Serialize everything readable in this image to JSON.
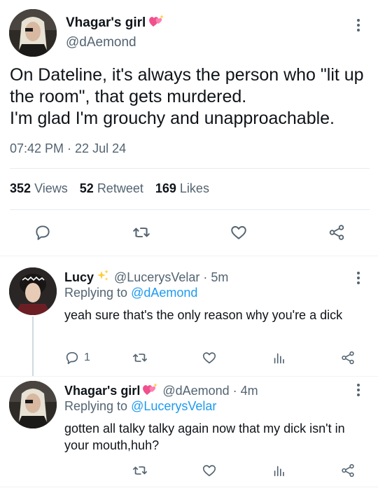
{
  "main_tweet": {
    "display_name": "Vhagar's girl",
    "handle": "@dAemond",
    "text": "On Dateline, it's always the person who \"lit up the room\", that gets murdered.\nI'm glad I'm grouchy and unapproachable.",
    "timestamp": "07:42 PM · 22 Jul 24",
    "stats": {
      "views_count": "352",
      "views_label": "Views",
      "retweets_count": "52",
      "retweets_label": "Retweet",
      "likes_count": "169",
      "likes_label": "Likes"
    }
  },
  "replies": [
    {
      "display_name": "Lucy",
      "handle_time": "@LucerysVelar · 5m",
      "replying_prefix": "Replying to",
      "replying_to": "@dAemond",
      "text": "yeah sure that's the only reason why you're a dick",
      "reply_count": "1"
    },
    {
      "display_name": "Vhagar's girl",
      "handle_time": "@dAemond · 4m",
      "replying_prefix": "Replying to",
      "replying_to": "@LucerysVelar",
      "text": "gotten all talky talky again now that my dick isn't in your mouth,huh?",
      "reply_count": ""
    }
  ],
  "icons": {
    "reply": "comment-bubble-icon",
    "retweet": "retweet-icon",
    "like": "heart-icon",
    "share": "share-icon",
    "views": "analytics-bars-icon",
    "more": "more-vertical-icon"
  },
  "colors": {
    "link_blue": "#1d9bf0",
    "secondary_text": "#536471",
    "heart_emoji": "#f0508c",
    "sparkle_emoji": "#ffcc33"
  }
}
